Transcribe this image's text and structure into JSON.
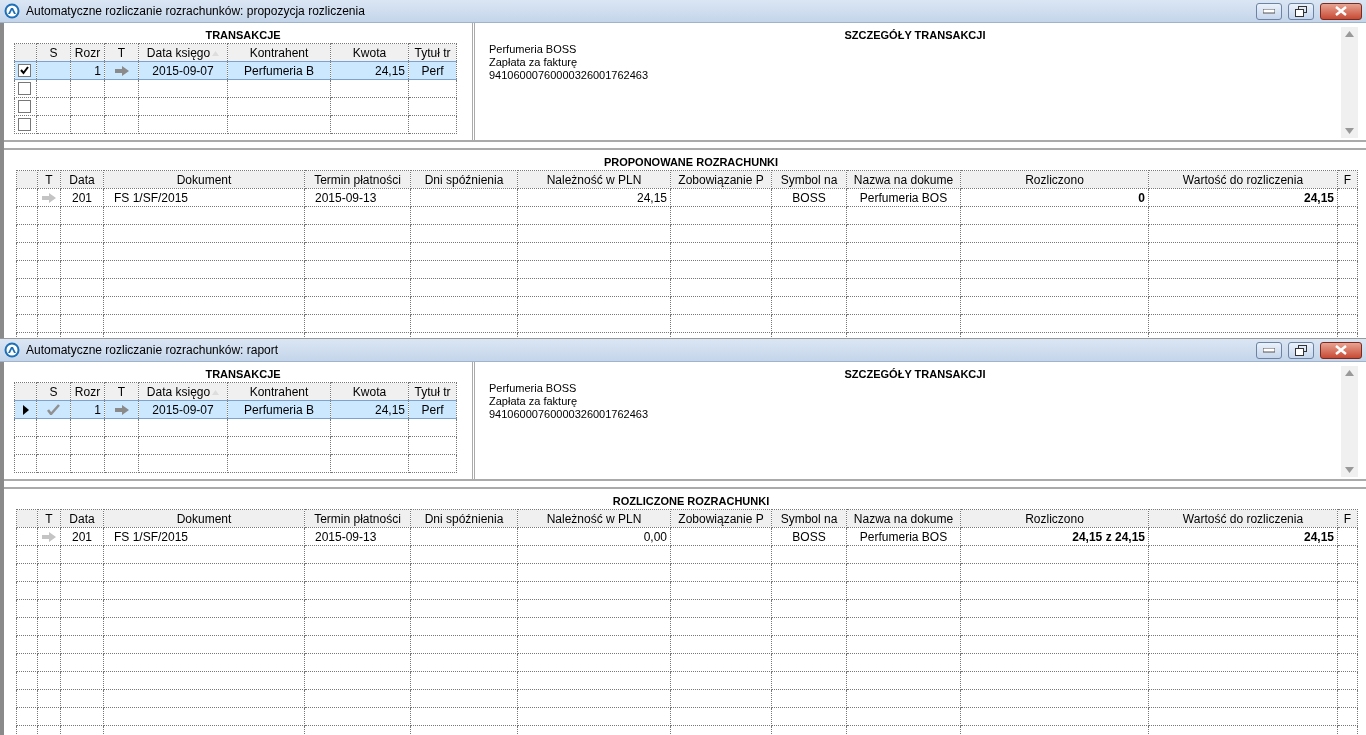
{
  "windows": [
    {
      "title": "Automatyczne rozliczanie rozrachunków: propozycja rozliczenia",
      "transactions": {
        "title": "TRANSAKCJE",
        "columns": [
          {
            "label": "S"
          },
          {
            "label": "Rozr"
          },
          {
            "label": "T"
          },
          {
            "label": "Data księgo",
            "sort_ascending": true
          },
          {
            "label": "Kontrahent"
          },
          {
            "label": "Kwota"
          },
          {
            "label": "Tytuł tr"
          }
        ],
        "rows": [
          {
            "kind": "checkbox",
            "checked": true,
            "selected": true,
            "settled": false,
            "rozr": "1",
            "incoming": true,
            "data": "2015-09-07",
            "kontrahent": "Perfumeria B",
            "kwota": "24,15",
            "tytul": "Perf"
          },
          {
            "kind": "checkbox",
            "checked": false,
            "selected": false
          },
          {
            "kind": "checkbox",
            "checked": false,
            "selected": false
          },
          {
            "kind": "checkbox",
            "checked": false,
            "selected": false
          }
        ]
      },
      "details": {
        "title": "SZCZEGÓŁY TRANSAKCJI",
        "lines": [
          "Perfumeria BOSS",
          "Zapłata za fakturę",
          "94106000760000326001762463"
        ]
      },
      "settlements": {
        "title": "PROPONOWANE ROZRACHUNKI",
        "columns": [
          "T",
          "Data",
          "Dokument",
          "Termin płatności",
          "Dni spóźnienia",
          "Należność w PLN",
          "Zobowiązanie P",
          "Symbol na",
          "Nazwa na dokume",
          "Rozliczono",
          "Wartość do rozliczenia",
          "F"
        ],
        "rows": [
          {
            "incoming": true,
            "data": "201",
            "dokument": "FS 1/SF/2015",
            "termin": "2015-09-13",
            "naleznosc": "24,15",
            "symbol": "BOSS",
            "nazwa": "Perfumeria BOS",
            "rozliczono": "0",
            "wartosc": "24,15"
          }
        ]
      }
    },
    {
      "title": "Automatyczne rozliczanie rozrachunków: raport",
      "transactions": {
        "title": "TRANSAKCJE",
        "columns": [
          {
            "label": "S"
          },
          {
            "label": "Rozr"
          },
          {
            "label": "T"
          },
          {
            "label": "Data księgo",
            "sort_ascending": true
          },
          {
            "label": "Kontrahent"
          },
          {
            "label": "Kwota"
          },
          {
            "label": "Tytuł tr"
          }
        ],
        "rows": [
          {
            "kind": "pointer",
            "current": true,
            "selected": true,
            "settled": true,
            "rozr": "1",
            "incoming": true,
            "data": "2015-09-07",
            "kontrahent": "Perfumeria B",
            "kwota": "24,15",
            "tytul": "Perf"
          }
        ]
      },
      "details": {
        "title": "SZCZEGÓŁY TRANSAKCJI",
        "lines": [
          "Perfumeria BOSS",
          "Zapłata za fakturę",
          "94106000760000326001762463"
        ]
      },
      "settlements": {
        "title": "ROZLICZONE ROZRACHUNKI",
        "columns": [
          "T",
          "Data",
          "Dokument",
          "Termin płatności",
          "Dni spóźnienia",
          "Należność w PLN",
          "Zobowiązanie P",
          "Symbol na",
          "Nazwa na dokume",
          "Rozliczono",
          "Wartość do rozliczenia",
          "F"
        ],
        "rows": [
          {
            "incoming": true,
            "data": "201",
            "dokument": "FS 1/SF/2015",
            "termin": "2015-09-13",
            "naleznosc": "0,00",
            "symbol": "BOSS",
            "nazwa": "Perfumeria BOS",
            "rozliczono": "24,15 z 24,15",
            "wartosc": "24,15"
          }
        ]
      }
    }
  ]
}
